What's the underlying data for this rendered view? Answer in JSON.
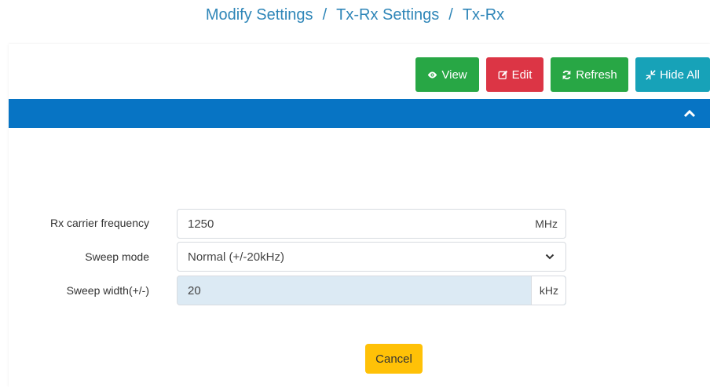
{
  "breadcrumb": {
    "items": [
      "Modify Settings",
      "Tx-Rx Settings",
      "Tx-Rx"
    ],
    "separator": "/"
  },
  "toolbar": {
    "view_label": "View",
    "edit_label": "Edit",
    "refresh_label": "Refresh",
    "hide_all_label": "Hide All"
  },
  "form": {
    "rx_carrier_frequency": {
      "label": "Rx carrier frequency",
      "value": "1250",
      "unit": "MHz"
    },
    "sweep_mode": {
      "label": "Sweep mode",
      "value": "Normal (+/-20kHz)"
    },
    "sweep_width": {
      "label": "Sweep width(+/-)",
      "value": "20",
      "unit": "kHz"
    }
  },
  "actions": {
    "cancel_label": "Cancel"
  },
  "colors": {
    "view": "#28a745",
    "edit": "#dc3545",
    "refresh": "#28a745",
    "hide_all": "#17a2b8",
    "header_bar": "#0774c4",
    "cancel": "#ffc107",
    "breadcrumb": "#2f86b8"
  },
  "icons": {
    "view": "eye-icon",
    "edit": "edit-icon",
    "refresh": "refresh-icon",
    "hide_all": "compress-icon",
    "collapse": "chevron-up-icon",
    "select": "chevron-down-icon"
  }
}
